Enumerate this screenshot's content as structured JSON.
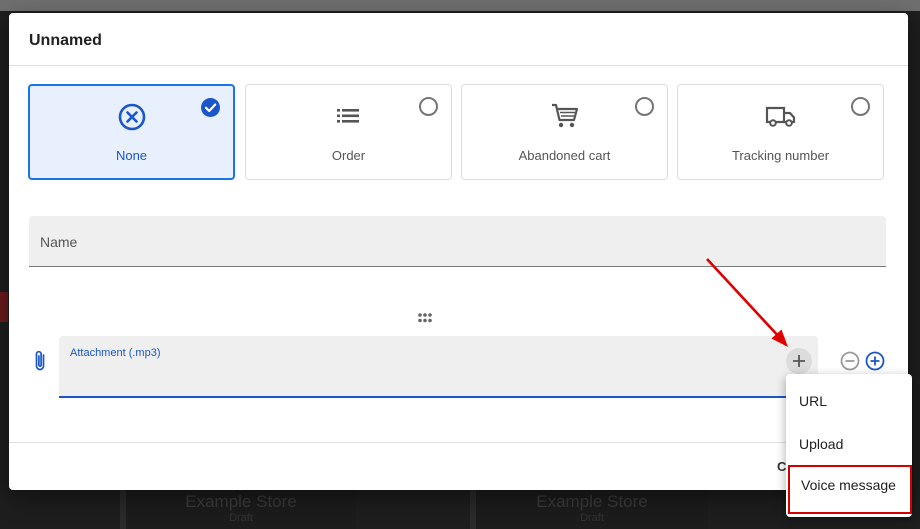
{
  "dialog": {
    "title": "Unnamed"
  },
  "types": [
    {
      "label": "None",
      "icon": "cancel-circle-icon",
      "selected": true
    },
    {
      "label": "Order",
      "icon": "list-icon",
      "selected": false
    },
    {
      "label": "Abandoned cart",
      "icon": "shopping-cart-icon",
      "selected": false
    },
    {
      "label": "Tracking number",
      "icon": "truck-icon",
      "selected": false
    }
  ],
  "name_field": {
    "label": "Name",
    "value": ""
  },
  "attachment": {
    "label": "Attachment (.mp3)",
    "value": ""
  },
  "menu": {
    "items": [
      {
        "label": "URL"
      },
      {
        "label": "Upload"
      },
      {
        "label": "Voice message",
        "highlighted": true
      }
    ]
  },
  "footer": {
    "partial_button_text": "C"
  },
  "background": {
    "tile_title": "Example Store",
    "tile_sub": "Draft"
  },
  "colors": {
    "accent": "#1a73e8",
    "accent_text": "#1a56c9",
    "annotation": "#e00000",
    "selected_bg": "#e8f0fe"
  }
}
